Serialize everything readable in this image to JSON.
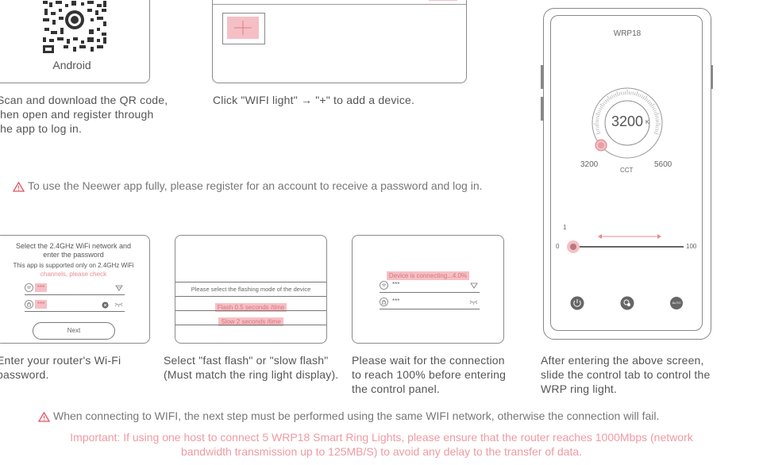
{
  "step1": {
    "os_label": "Android",
    "caption": [
      "Scan and download the QR code,",
      "then open and register through",
      "the app to log in."
    ]
  },
  "step2": {
    "caption": "Click \"WIFI light\" → \"+\" to add a device.",
    "add_icon": "plus-icon"
  },
  "notice1": "To use the Neewer app fully, please register for an account to receive a  password and log in.",
  "wifi_panel": {
    "title": [
      "Select the 2.4GHz WiFi network and",
      "enter the password"
    ],
    "subtitle": [
      "This app is supported only on 2.4GHz WiFi",
      "channels, please check"
    ],
    "network_value": "***",
    "password_value": "***",
    "next_label": "Next",
    "caption": [
      "Enter your router's Wi-Fi",
      "password."
    ]
  },
  "flash_panel": {
    "prompt": "Please select the flashing mode of the device",
    "fast": "Flash 0.5 seconds /time",
    "slow": "Slow  2 seconds /time",
    "caption": [
      "Select  \"fast flash\" or \"slow flash\"",
      "(Must match the ring light display)."
    ]
  },
  "connect_panel": {
    "status": "Device is connecting...4.0%",
    "network_value": "***",
    "password_value": "***",
    "caption": [
      "Please wait for the connection",
      "to reach 100% before entering",
      "the control panel."
    ]
  },
  "phone": {
    "title": "WRP18",
    "cct_value": "3200",
    "cct_unit": "K",
    "cct_min": "3200",
    "cct_label": "CCT",
    "cct_max": "5600",
    "brightness_top": "1",
    "brightness_min": "0",
    "brightness_max": "100",
    "buttons": [
      "power-icon",
      "scene-icon",
      "auto-icon"
    ],
    "auto_label": "AUTO",
    "caption": [
      "After entering the above screen,",
      "slide the control tab to control the",
      "WRP ring light."
    ]
  },
  "notice2": "When connecting to WIFI, the next step must be performed using the same WIFI network, otherwise the connection will fail.",
  "important": [
    "Important: If using one host to connect 5 WRP18 Smart Ring Lights, please ensure that the router reaches 1000Mbps (network",
    "bandwidth transmission up to 125MB/S) to avoid any delay to the transfer of data."
  ],
  "colors": {
    "accent_pink": "#f5c0c5",
    "text_pink": "#e88b93",
    "warning_red": "#e0555f"
  }
}
